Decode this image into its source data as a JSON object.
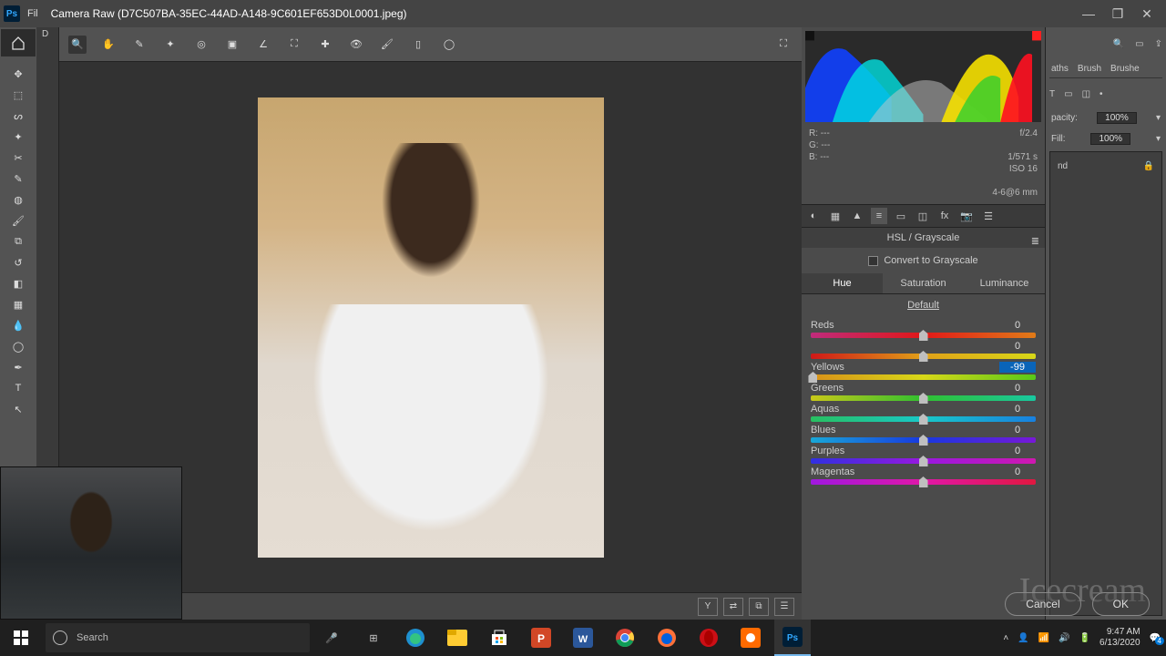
{
  "window": {
    "app_abbrev": "Ps",
    "file_abbrev": "Fil",
    "title": "Camera Raw (D7C507BA-35EC-44AD-A148-9C601EF653D0L0001.jpeg)"
  },
  "meta": {
    "r": "R:   ---",
    "g": "G:   ---",
    "b": "B:   ---",
    "aperture": "f/2.4",
    "shutter": "1/571 s",
    "iso": "ISO 16",
    "focal": "4-6@6 mm"
  },
  "hsl_panel": {
    "title": "HSL / Grayscale",
    "grayscale_label": "Convert to Grayscale",
    "tabs": {
      "hue": "Hue",
      "saturation": "Saturation",
      "luminance": "Luminance"
    },
    "default_link": "Default",
    "sliders": {
      "reds": {
        "label": "Reds",
        "value": "0",
        "pos": 50
      },
      "oranges": {
        "label": "",
        "value": "0",
        "pos": 50
      },
      "yellows": {
        "label": "Yellows",
        "value": "-99",
        "pos": 1
      },
      "greens": {
        "label": "Greens",
        "value": "0",
        "pos": 50
      },
      "aquas": {
        "label": "Aquas",
        "value": "0",
        "pos": 50
      },
      "blues": {
        "label": "Blues",
        "value": "0",
        "pos": 50
      },
      "purples": {
        "label": "Purples",
        "value": "0",
        "pos": 50
      },
      "magentas": {
        "label": "Magentas",
        "value": "0",
        "pos": 50
      }
    }
  },
  "dialog": {
    "cancel": "Cancel",
    "ok": "OK"
  },
  "ps_panels": {
    "tabs_row1_a": "aths",
    "tabs_row1_b": "Brush",
    "tabs_row1_c": "Brushe",
    "opacity_label": "pacity:",
    "opacity_value": "100%",
    "fill_label": "Fill:",
    "fill_value": "100%",
    "layer_name": "nd"
  },
  "taskbar": {
    "search_placeholder": "Search",
    "time": "9:47 AM",
    "date": "6/13/2020",
    "notif_count": "4"
  },
  "watermark": "Icecream"
}
